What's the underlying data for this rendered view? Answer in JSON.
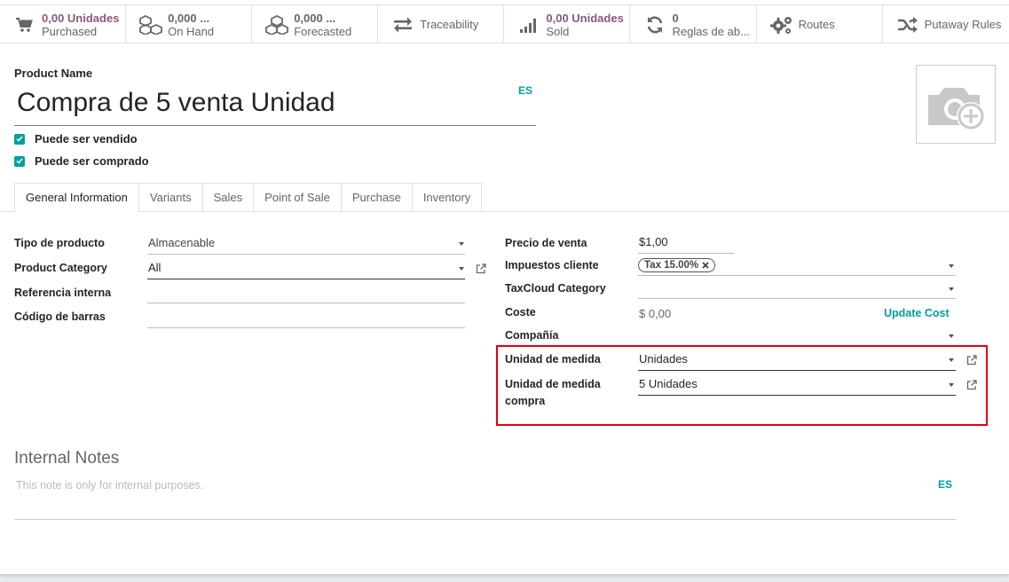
{
  "smart_buttons": [
    {
      "value": "0,00 Unidades",
      "label": "Purchased",
      "icon": "cart-icon"
    },
    {
      "value": "0,000 ...",
      "label": "On Hand",
      "icon": "cubes-icon"
    },
    {
      "value": "0,000 ...",
      "label": "Forecasted",
      "icon": "cubes-icon"
    },
    {
      "value": "",
      "label": "Traceability",
      "icon": "exchange-icon"
    },
    {
      "value": "0,00 Unidades",
      "label": "Sold",
      "icon": "signal-icon"
    },
    {
      "value": "0",
      "label": "Reglas de ab...",
      "icon": "refresh-icon"
    },
    {
      "value": "",
      "label": "Routes",
      "icon": "cogs-icon"
    },
    {
      "value": "",
      "label": "Putaway Rules",
      "icon": "random-icon"
    }
  ],
  "form": {
    "product_name_label": "Product Name",
    "product_name": "Compra de 5 venta Unidad",
    "lang": "ES",
    "can_be_sold": "Puede ser vendido",
    "can_be_purchased": "Puede ser comprado"
  },
  "tabs": [
    "General Information",
    "Variants",
    "Sales",
    "Point of Sale",
    "Purchase",
    "Inventory"
  ],
  "left_fields": {
    "product_type_label": "Tipo de producto",
    "product_type": "Almacenable",
    "category_label": "Product Category",
    "category": "All",
    "internal_ref_label": "Referencia interna",
    "barcode_label": "Código de barras"
  },
  "right_fields": {
    "sale_price_label": "Precio de venta",
    "sale_price": "$1,00",
    "taxes_label": "Impuestos cliente",
    "tax_tag": "Tax 15.00%",
    "taxcloud_label": "TaxCloud Category",
    "cost_label": "Coste",
    "cost": "$ 0,00",
    "update_cost": "Update Cost",
    "company_label": "Compañía",
    "uom_label": "Unidad de medida",
    "uom": "Unidades",
    "purchase_uom_label_1": "Unidad de medida",
    "purchase_uom_label_2": "compra",
    "purchase_uom": "5 Unidades"
  },
  "notes": {
    "title": "Internal Notes",
    "placeholder": "This note is only for internal purposes.",
    "lang": "ES"
  },
  "colors": {
    "accent": "#00a09d",
    "brand": "#875a7b",
    "highlight": "#e3000f"
  }
}
